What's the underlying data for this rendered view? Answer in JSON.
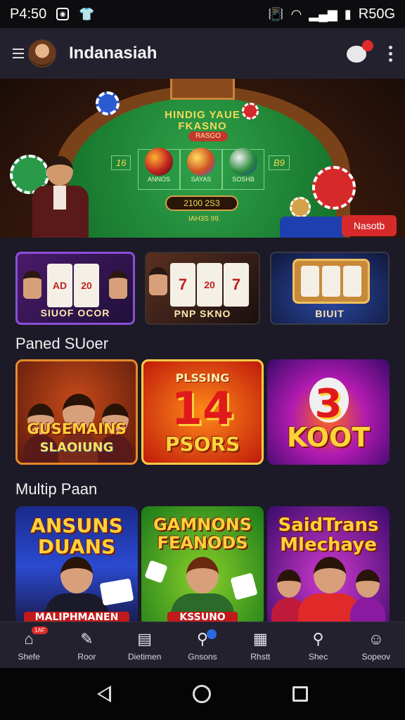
{
  "status_bar": {
    "time": "P4:50",
    "right_text": "R50G",
    "icons": [
      "messenger-icon",
      "shirt-icon",
      "vibrate-icon",
      "wifi-icon",
      "signal-icon",
      "battery-icon"
    ]
  },
  "header": {
    "title": "Indanasiah",
    "icons": [
      "menu-icon",
      "avatar",
      "chat-icon",
      "more-vert-icon"
    ]
  },
  "hero": {
    "title_line1": "HINDIG YAUE",
    "title_line2": "FKASNO",
    "sub_pill": "RASGO",
    "side_left": "16",
    "side_right": "B9",
    "ball_labels": [
      "ANNOS",
      "SAYAS",
      "SOSHB"
    ],
    "amount": "2100 2S3",
    "small_text": "IAH3S 99.",
    "badge_label": "Nasotb"
  },
  "thumbnails": [
    {
      "label": "SIUOF OCOR",
      "reels": [
        "AD",
        "20",
        "AD"
      ]
    },
    {
      "label": "PNP SKNO",
      "reels": [
        "7",
        "20",
        "7"
      ]
    },
    {
      "label": "BIUIT",
      "reels": [
        "",
        "",
        ""
      ]
    }
  ],
  "sections": {
    "first": "Paned SUoer",
    "second": "Multip Paan"
  },
  "cards_row1": [
    {
      "title": "GUSEMAINS",
      "sub": "SLAOIUNG"
    },
    {
      "title": "14",
      "top": "PLSSING",
      "sub": "PSORS"
    },
    {
      "title": "3",
      "sub": "KOOT"
    }
  ],
  "cards_row2": [
    {
      "title": "ANSUNS",
      "title2": "DUANS",
      "sub": "MALIPHMANEN"
    },
    {
      "title": "GAMNONS",
      "title2": "FEANODS",
      "sub": "KSSUNO"
    },
    {
      "title": "SaidTrans",
      "title2": "Mlechaye",
      "sub": ""
    }
  ],
  "bottom_nav": [
    {
      "label": "Shefe",
      "icon": "home-icon",
      "badge": "1AF"
    },
    {
      "label": "Roor",
      "icon": "tag-icon"
    },
    {
      "label": "Dietimen",
      "icon": "document-icon"
    },
    {
      "label": "Gnsons",
      "icon": "search-icon"
    },
    {
      "label": "Rhstt",
      "icon": "newspaper-icon"
    },
    {
      "label": "Shec",
      "icon": "search-icon"
    },
    {
      "label": "Sopeov",
      "icon": "person-icon"
    }
  ]
}
